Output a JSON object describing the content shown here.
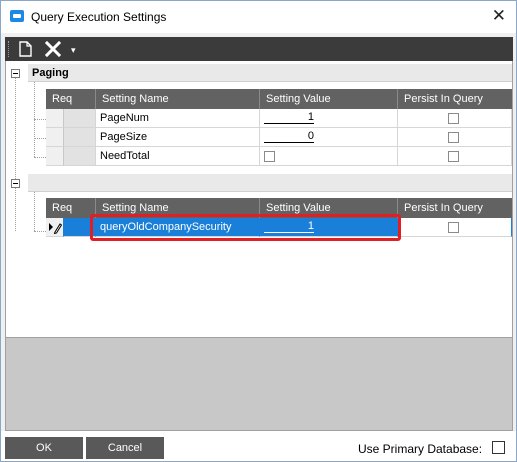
{
  "window": {
    "title": "Query Execution Settings",
    "close_glyph": "✕"
  },
  "toolbar": {
    "new_icon": "new-document-icon",
    "delete_icon": "delete-x-icon",
    "dropdown_glyph": "▾"
  },
  "band1": {
    "label": "Paging",
    "columns": [
      "Req",
      "Setting Name",
      "Setting Value",
      "Persist In Query"
    ],
    "rows": [
      {
        "name": "PageNum",
        "value": "1",
        "value_type": "number",
        "persist": false
      },
      {
        "name": "PageSize",
        "value": "0",
        "value_type": "number",
        "persist": false
      },
      {
        "name": "NeedTotal",
        "value": "",
        "value_type": "checkbox",
        "persist": false
      }
    ]
  },
  "band2": {
    "label": "",
    "columns": [
      "Req",
      "Setting Name",
      "Setting Value",
      "Persist In Query"
    ],
    "rows": [
      {
        "name": "queryOldCompanySecurity",
        "value": "1",
        "value_type": "number",
        "persist": false,
        "selected": true
      }
    ]
  },
  "footer": {
    "ok_label": "OK",
    "cancel_label": "Cancel",
    "primary_db_label": "Use Primary Database:",
    "primary_db_checked": false
  },
  "colors": {
    "selection": "#1a7fd8",
    "highlight": "#e01e24",
    "toolbar": "#3b3b3b",
    "header": "#626262"
  }
}
